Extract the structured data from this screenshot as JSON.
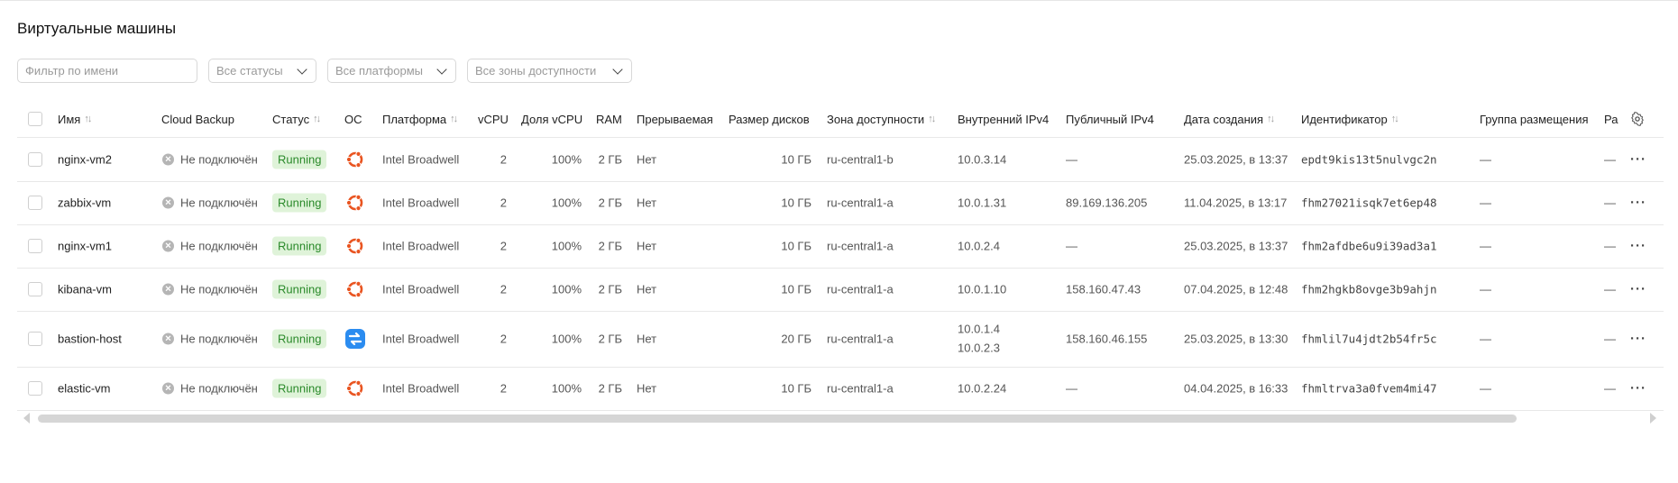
{
  "page": {
    "title": "Виртуальные машины"
  },
  "filters": {
    "name_placeholder": "Фильтр по имени",
    "status": "Все статусы",
    "platform": "Все платформы",
    "zone": "Все зоны доступности"
  },
  "table": {
    "headers": {
      "name": "Имя",
      "backup": "Cloud Backup",
      "status": "Статус",
      "os": "ОС",
      "platform": "Платформа",
      "vcpu": "vCPU",
      "vcpu_share": "Доля vCPU",
      "ram": "RAM",
      "preemptible": "Прерываемая",
      "disk": "Размер дисков",
      "zone": "Зона доступности",
      "ipv4_int": "Внутренний IPv4",
      "ipv4_pub": "Публичный IPv4",
      "created": "Дата создания",
      "id": "Идентификатор",
      "group": "Группа размещения",
      "extra": "Ра"
    },
    "rows": [
      {
        "name": "nginx-vm2",
        "backup": "Не подключён",
        "status": "Running",
        "os": "ubuntu",
        "platform": "Intel Broadwell",
        "vcpu": "2",
        "share": "100%",
        "ram": "2 ГБ",
        "preempt": "Нет",
        "disk": "10 ГБ",
        "zone": "ru-central1-b",
        "ip_int": "10.0.3.14",
        "ip_int2": "",
        "ip_pub": "—",
        "created": "25.03.2025, в 13:37",
        "id": "epdt9kis13t5nulvgc2n",
        "group": "—",
        "extra": "—"
      },
      {
        "name": "zabbix-vm",
        "backup": "Не подключён",
        "status": "Running",
        "os": "ubuntu",
        "platform": "Intel Broadwell",
        "vcpu": "2",
        "share": "100%",
        "ram": "2 ГБ",
        "preempt": "Нет",
        "disk": "10 ГБ",
        "zone": "ru-central1-a",
        "ip_int": "10.0.1.31",
        "ip_int2": "",
        "ip_pub": "89.169.136.205",
        "created": "11.04.2025, в 13:17",
        "id": "fhm27021isqk7et6ep48",
        "group": "—",
        "extra": "—"
      },
      {
        "name": "nginx-vm1",
        "backup": "Не подключён",
        "status": "Running",
        "os": "ubuntu",
        "platform": "Intel Broadwell",
        "vcpu": "2",
        "share": "100%",
        "ram": "2 ГБ",
        "preempt": "Нет",
        "disk": "10 ГБ",
        "zone": "ru-central1-a",
        "ip_int": "10.0.2.4",
        "ip_int2": "",
        "ip_pub": "—",
        "created": "25.03.2025, в 13:37",
        "id": "fhm2afdbe6u9i39ad3a1",
        "group": "—",
        "extra": "—"
      },
      {
        "name": "kibana-vm",
        "backup": "Не подключён",
        "status": "Running",
        "os": "ubuntu",
        "platform": "Intel Broadwell",
        "vcpu": "2",
        "share": "100%",
        "ram": "2 ГБ",
        "preempt": "Нет",
        "disk": "10 ГБ",
        "zone": "ru-central1-a",
        "ip_int": "10.0.1.10",
        "ip_int2": "",
        "ip_pub": "158.160.47.43",
        "created": "07.04.2025, в 12:48",
        "id": "fhm2hgkb8ovge3b9ahjn",
        "group": "—",
        "extra": "—"
      },
      {
        "name": "bastion-host",
        "backup": "Не подключён",
        "status": "Running",
        "os": "nat",
        "platform": "Intel Broadwell",
        "vcpu": "2",
        "share": "100%",
        "ram": "2 ГБ",
        "preempt": "Нет",
        "disk": "20 ГБ",
        "zone": "ru-central1-a",
        "ip_int": "10.0.1.4",
        "ip_int2": "10.0.2.3",
        "ip_pub": "158.160.46.155",
        "created": "25.03.2025, в 13:30",
        "id": "fhmlil7u4jdt2b54fr5c",
        "group": "—",
        "extra": "—"
      },
      {
        "name": "elastic-vm",
        "backup": "Не подключён",
        "status": "Running",
        "os": "ubuntu",
        "platform": "Intel Broadwell",
        "vcpu": "2",
        "share": "100%",
        "ram": "2 ГБ",
        "preempt": "Нет",
        "disk": "10 ГБ",
        "zone": "ru-central1-a",
        "ip_int": "10.0.2.24",
        "ip_int2": "",
        "ip_pub": "—",
        "created": "04.04.2025, в 16:33",
        "id": "fhmltrva3a0fvem4mi47",
        "group": "—",
        "extra": "—"
      }
    ]
  },
  "colors": {
    "running_bg": "#dff3d9",
    "running_fg": "#2a8a2a",
    "ubuntu": "#e95420",
    "nat": "#2b8cf0"
  },
  "icons": {
    "sort": "sort-arrows-icon",
    "settings": "gear-icon",
    "more": "more-dots-icon"
  }
}
